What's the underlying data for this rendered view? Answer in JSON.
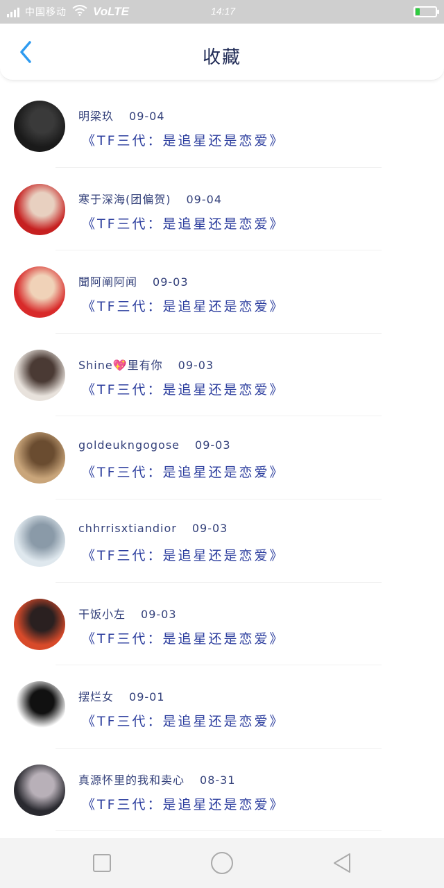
{
  "status_bar": {
    "carrier": "中国移动",
    "volte": "VoLTE",
    "time": "14:17",
    "signal_icon": "signal-icon",
    "wifi_icon": "wifi-icon",
    "battery_icon": "battery-icon"
  },
  "header": {
    "title": "收藏",
    "back_icon": "chevron-left-icon",
    "accent": "#2f9bf0"
  },
  "items": [
    {
      "name": "明梁玖",
      "date": "09-04",
      "subtitle": "《TF三代：是追星还是恋爱》",
      "avatar_colors": [
        "#1a1a1a",
        "#3a3a3a"
      ]
    },
    {
      "name": "寒于深海(团偏贺)",
      "date": "09-04",
      "subtitle": "《TF三代：是追星还是恋爱》",
      "avatar_colors": [
        "#c62020",
        "#e8d0c0"
      ]
    },
    {
      "name": "聞阿阐阿闻",
      "date": "09-03",
      "subtitle": "《TF三代：是追星还是恋爱》",
      "avatar_colors": [
        "#d82a2a",
        "#f0d2b8"
      ]
    },
    {
      "name": "Shine",
      "name_suffix": "里有你",
      "heart": "💖",
      "date": "09-03",
      "subtitle": "《TF三代：是追星还是恋爱》",
      "avatar_colors": [
        "#e8e2dc",
        "#4a3a34"
      ]
    },
    {
      "name": "goldeukngogose",
      "date": "09-03",
      "subtitle": "《TF三代：是追星还是恋爱》",
      "avatar_colors": [
        "#c9a57a",
        "#6a4c30"
      ]
    },
    {
      "name": "chhrrisxtiandior",
      "date": "09-03",
      "subtitle": "《TF三代：是追星还是恋爱》",
      "avatar_colors": [
        "#dfe8ee",
        "#8a9aa8"
      ]
    },
    {
      "name": "干饭小左",
      "date": "09-03",
      "subtitle": "《TF三代：是追星还是恋爱》",
      "avatar_colors": [
        "#d84a2a",
        "#2a2020"
      ]
    },
    {
      "name": "摆烂女",
      "date": "09-01",
      "subtitle": "《TF三代：是追星还是恋爱》",
      "avatar_colors": [
        "#ffffff",
        "#111111"
      ]
    },
    {
      "name": "真源怀里的我和卖心",
      "date": "08-31",
      "subtitle": "《TF三代：是追星还是恋爱》",
      "avatar_colors": [
        "#2a2a30",
        "#b8b0b8"
      ]
    }
  ],
  "navbar": {
    "recents_icon": "square-icon",
    "home_icon": "circle-icon",
    "back_icon": "triangle-back-icon"
  }
}
